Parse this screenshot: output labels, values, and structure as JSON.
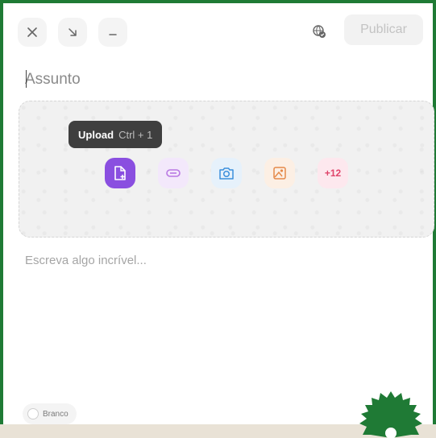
{
  "toolbar": {
    "close_icon": "close-icon",
    "minimize_to_corner_icon": "arrow-down-right-icon",
    "minimize_icon": "minus-icon",
    "status_icon": "globe-check-icon",
    "publish_label": "Publicar"
  },
  "subject": {
    "placeholder": "Assunto"
  },
  "media": {
    "tooltip_label": "Upload",
    "tooltip_shortcut": "Ctrl + 1",
    "buttons": [
      {
        "icon": "upload-file-icon",
        "color": "#8a4fe0"
      },
      {
        "icon": "link-icon",
        "color": "#b979e3"
      },
      {
        "icon": "camera-icon",
        "color": "#3c8fdc"
      },
      {
        "icon": "image-icon",
        "color": "#e58a4a"
      },
      {
        "label": "+12",
        "color": "#e0456b"
      }
    ]
  },
  "body": {
    "placeholder": "Escreva algo incrível..."
  },
  "background_option": {
    "label": "Branco"
  },
  "colors": {
    "frame_border": "#1f7a35",
    "badge": "#1f7a35",
    "publish_disabled_text": "#c3c3c3"
  }
}
